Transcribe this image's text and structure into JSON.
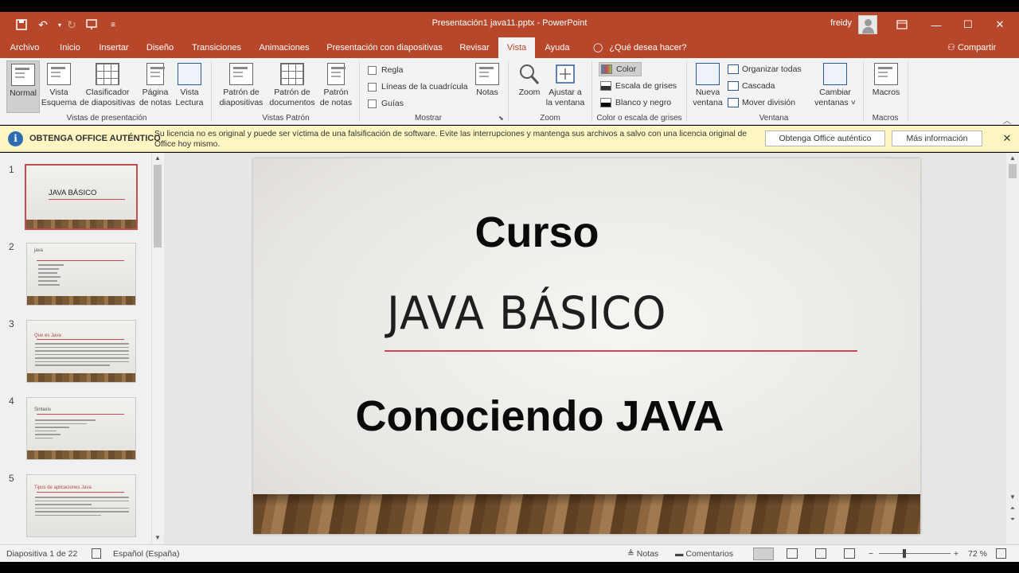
{
  "titlebar": {
    "doc_title": "Presentación1 java11.pptx  -  PowerPoint",
    "user_name": "freidy",
    "icons": [
      "save-icon",
      "undo-icon",
      "redo-icon",
      "from-beginning-icon",
      "customize-quick-access-icon"
    ]
  },
  "tabs": [
    {
      "label": "Archivo"
    },
    {
      "label": "Inicio"
    },
    {
      "label": "Insertar"
    },
    {
      "label": "Diseño"
    },
    {
      "label": "Transiciones"
    },
    {
      "label": "Animaciones"
    },
    {
      "label": "Presentación con diapositivas"
    },
    {
      "label": "Revisar"
    },
    {
      "label": "Vista"
    },
    {
      "label": "Ayuda"
    }
  ],
  "active_tab": "Vista",
  "tell_me": "¿Qué desea hacer?",
  "share": "Compartir",
  "ribbon": {
    "vistas_presentacion": {
      "label": "Vistas de presentación",
      "normal": "Normal",
      "esquema_1": "Vista",
      "esquema_2": "Esquema",
      "clasificador_1": "Clasificador",
      "clasificador_2": "de diapositivas",
      "pagina_1": "Página",
      "pagina_2": "de notas",
      "lectura_1": "Vista",
      "lectura_2": "Lectura"
    },
    "vistas_patron": {
      "label": "Vistas Patrón",
      "diapositivas_1": "Patrón de",
      "diapositivas_2": "diapositivas",
      "documentos_1": "Patrón de",
      "documentos_2": "documentos",
      "notas_1": "Patrón",
      "notas_2": "de notas"
    },
    "mostrar": {
      "label": "Mostrar",
      "regla": "Regla",
      "lineas": "Líneas de la cuadrícula",
      "guias": "Guías",
      "notas": "Notas"
    },
    "zoom": {
      "label": "Zoom",
      "zoom": "Zoom",
      "ajustar_1": "Ajustar a",
      "ajustar_2": "la ventana"
    },
    "color": {
      "label": "Color o escala de grises",
      "color": "Color",
      "grises": "Escala de grises",
      "blanco_negro": "Blanco y negro",
      "colors": {
        "accent": "#b7472a",
        "slide_line": "#c74a57"
      }
    },
    "ventana": {
      "label": "Ventana",
      "nueva_1": "Nueva",
      "nueva_2": "ventana",
      "organizar": "Organizar todas",
      "cascada": "Cascada",
      "mover": "Mover división",
      "cambiar_1": "Cambiar",
      "cambiar_2": "ventanas ˅"
    },
    "macros": {
      "label": "Macros",
      "macros": "Macros"
    }
  },
  "infobar": {
    "title": "OBTENGA OFFICE AUTÉNTICO",
    "text": "Su licencia no es original y puede ser víctima de una falsificación de software. Evite las interrupciones y mantenga sus archivos a salvo con una licencia original de Office hoy mismo.",
    "btn_genuine": "Obtenga Office auténtico",
    "btn_more": "Más información"
  },
  "thumbnails": [
    {
      "num": "1",
      "title": "JAVA BÁSICO"
    },
    {
      "num": "2",
      "title": "java"
    },
    {
      "num": "3",
      "title": "Que es Java"
    },
    {
      "num": "4",
      "title": "Sintaxis"
    },
    {
      "num": "5",
      "title": "Tipos de aplicaciones Java"
    }
  ],
  "slide": {
    "curso": "Curso",
    "title": "JAVA BÁSICO",
    "subtitle": "Conociendo JAVA"
  },
  "statusbar": {
    "slide_count": "Diapositiva 1 de 22",
    "language": "Español (España)",
    "notas": "Notas",
    "comentarios": "Comentarios",
    "zoom_level": "72 %",
    "zoom_fraction": 0.36
  }
}
